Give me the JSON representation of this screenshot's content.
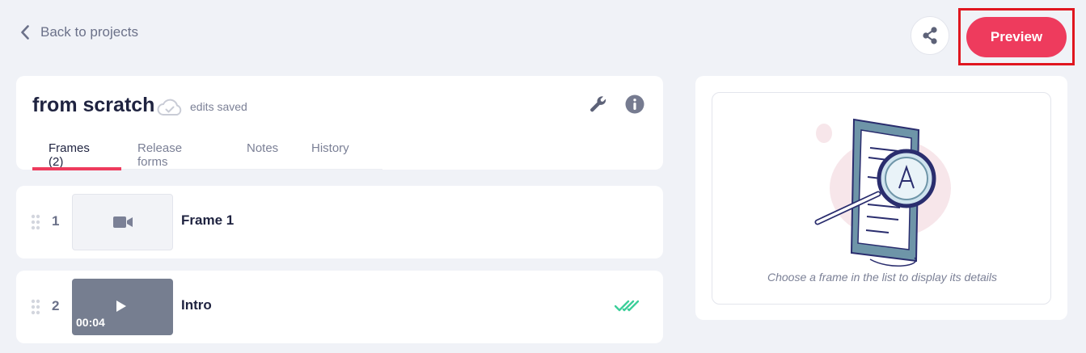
{
  "nav": {
    "back_label": "Back to projects"
  },
  "header": {
    "share_icon": "share-icon",
    "preview_label": "Preview"
  },
  "project": {
    "title": "from scratch",
    "save_status": "edits saved",
    "tabs": [
      {
        "label": "Frames (2)",
        "active": true
      },
      {
        "label": "Release forms",
        "active": false
      },
      {
        "label": "Notes",
        "active": false
      },
      {
        "label": "History",
        "active": false
      }
    ]
  },
  "frames": [
    {
      "number": "1",
      "name": "Frame 1",
      "thumbnail": "camera-icon",
      "duration": ""
    },
    {
      "number": "2",
      "name": "Intro",
      "thumbnail": "video",
      "duration": "00:04",
      "status_icon": "double-check-icon"
    }
  ],
  "detail": {
    "hint": "Choose a frame in the list to display its details"
  },
  "colors": {
    "accent": "#ee3b5d",
    "highlight": "#e0161f",
    "check": "#3ccf9a"
  }
}
